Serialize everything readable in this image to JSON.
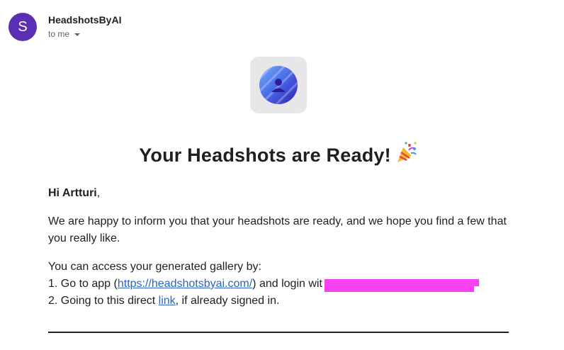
{
  "sender": {
    "avatar_letter": "S",
    "name": "HeadshotsByAI",
    "to_label": "to me"
  },
  "email": {
    "headline": "Your Headshots are Ready!",
    "headline_emoji": "party-popper-icon",
    "greeting_prefix": "Hi ",
    "greeting_name": "Artturi",
    "greeting_suffix": ",",
    "intro_text": "We are happy to inform you that your headshots are ready, and we hope you find a few that you really like.",
    "access_heading": "You can access your generated gallery by:",
    "step1_prefix": "1. Go to app (",
    "step1_link": "https://headshotsbyai.com/",
    "step1_suffix": ") and login wit",
    "step2_prefix": "2. Going to this direct ",
    "step2_link": "link",
    "step2_suffix": ", if already signed in."
  },
  "colors": {
    "avatar": "#5b2fb4",
    "link": "#2b63c4",
    "redaction": "#f740f2",
    "logo_tile": "#e7e7e9"
  }
}
